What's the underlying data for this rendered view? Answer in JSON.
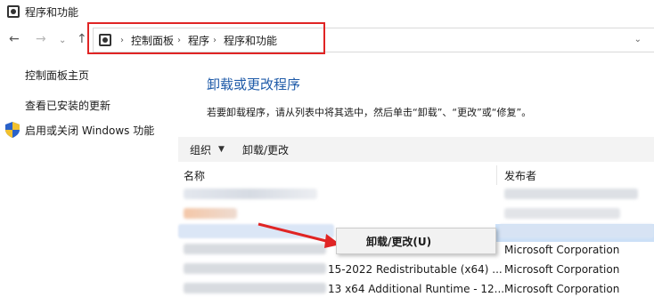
{
  "window": {
    "title": "程序和功能"
  },
  "nav": {
    "back": "←",
    "forward": "→",
    "dropdown": "⌄",
    "up": "↑"
  },
  "address": {
    "crumbs": [
      "控制面板",
      "程序",
      "程序和功能"
    ],
    "separator": "›",
    "dropdown": "⌄"
  },
  "sidebar": {
    "items": [
      {
        "label": "控制面板主页"
      },
      {
        "label": "查看已安装的更新"
      },
      {
        "label": "启用或关闭 Windows 功能"
      }
    ]
  },
  "main": {
    "title": "卸载或更改程序",
    "description": "若要卸载程序，请从列表中将其选中，然后单击“卸载”、“更改”或“修复”。"
  },
  "toolbar": {
    "organize_label": "组织",
    "organize_caret": "▼",
    "uninstall_label": "卸载/更改"
  },
  "table": {
    "columns": [
      "名称",
      "发布者"
    ],
    "rows": [
      {
        "name": "",
        "publisher": "Microsoft Corporation"
      },
      {
        "name": "15-2022 Redistributable (x64) ...",
        "publisher": "Microsoft Corporation"
      },
      {
        "name": "13 x64 Additional Runtime - 12...",
        "publisher": "Microsoft Corporation"
      }
    ]
  },
  "context_menu": {
    "items": [
      {
        "label": "卸载/更改(U)"
      }
    ]
  },
  "colors": {
    "accent": "#1e5aa8",
    "highlight_box": "#e02424",
    "selection": "#cce0f7"
  }
}
